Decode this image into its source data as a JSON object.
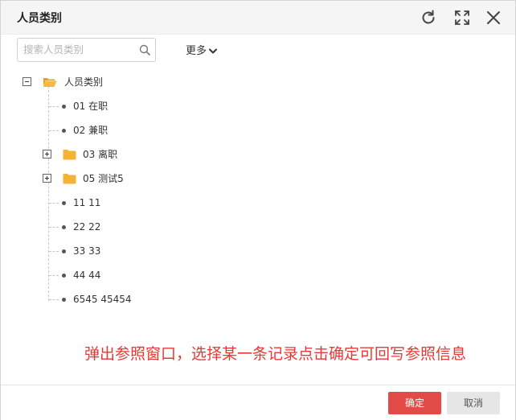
{
  "dialog": {
    "title": "人员类别",
    "buttons": {
      "refresh": "refresh-icon",
      "maximize": "maximize-icon",
      "close": "close-icon"
    }
  },
  "search": {
    "placeholder": "搜索人员类别",
    "value": "",
    "icon": "search-icon"
  },
  "more": {
    "label": "更多"
  },
  "tree": {
    "root": {
      "label": "人员类别",
      "expanded": true
    },
    "children": [
      {
        "label": "01 在职",
        "type": "leaf"
      },
      {
        "label": "02 兼职",
        "type": "leaf"
      },
      {
        "label": "03 离职",
        "type": "folder",
        "expanded": false
      },
      {
        "label": "05 测试5",
        "type": "folder",
        "expanded": false
      },
      {
        "label": "11 11",
        "type": "leaf"
      },
      {
        "label": "22 22",
        "type": "leaf"
      },
      {
        "label": "33 33",
        "type": "leaf"
      },
      {
        "label": "44 44",
        "type": "leaf"
      },
      {
        "label": "6545 45454",
        "type": "leaf"
      }
    ]
  },
  "annotation": {
    "text": "弹出参照窗口，选择某一条记录点击确定可回写参照信息"
  },
  "footer": {
    "confirm_label": "确定",
    "cancel_label": "取消"
  },
  "colors": {
    "accent": "#e24b47",
    "folder": "#f5b335",
    "annotation": "#e53935"
  }
}
